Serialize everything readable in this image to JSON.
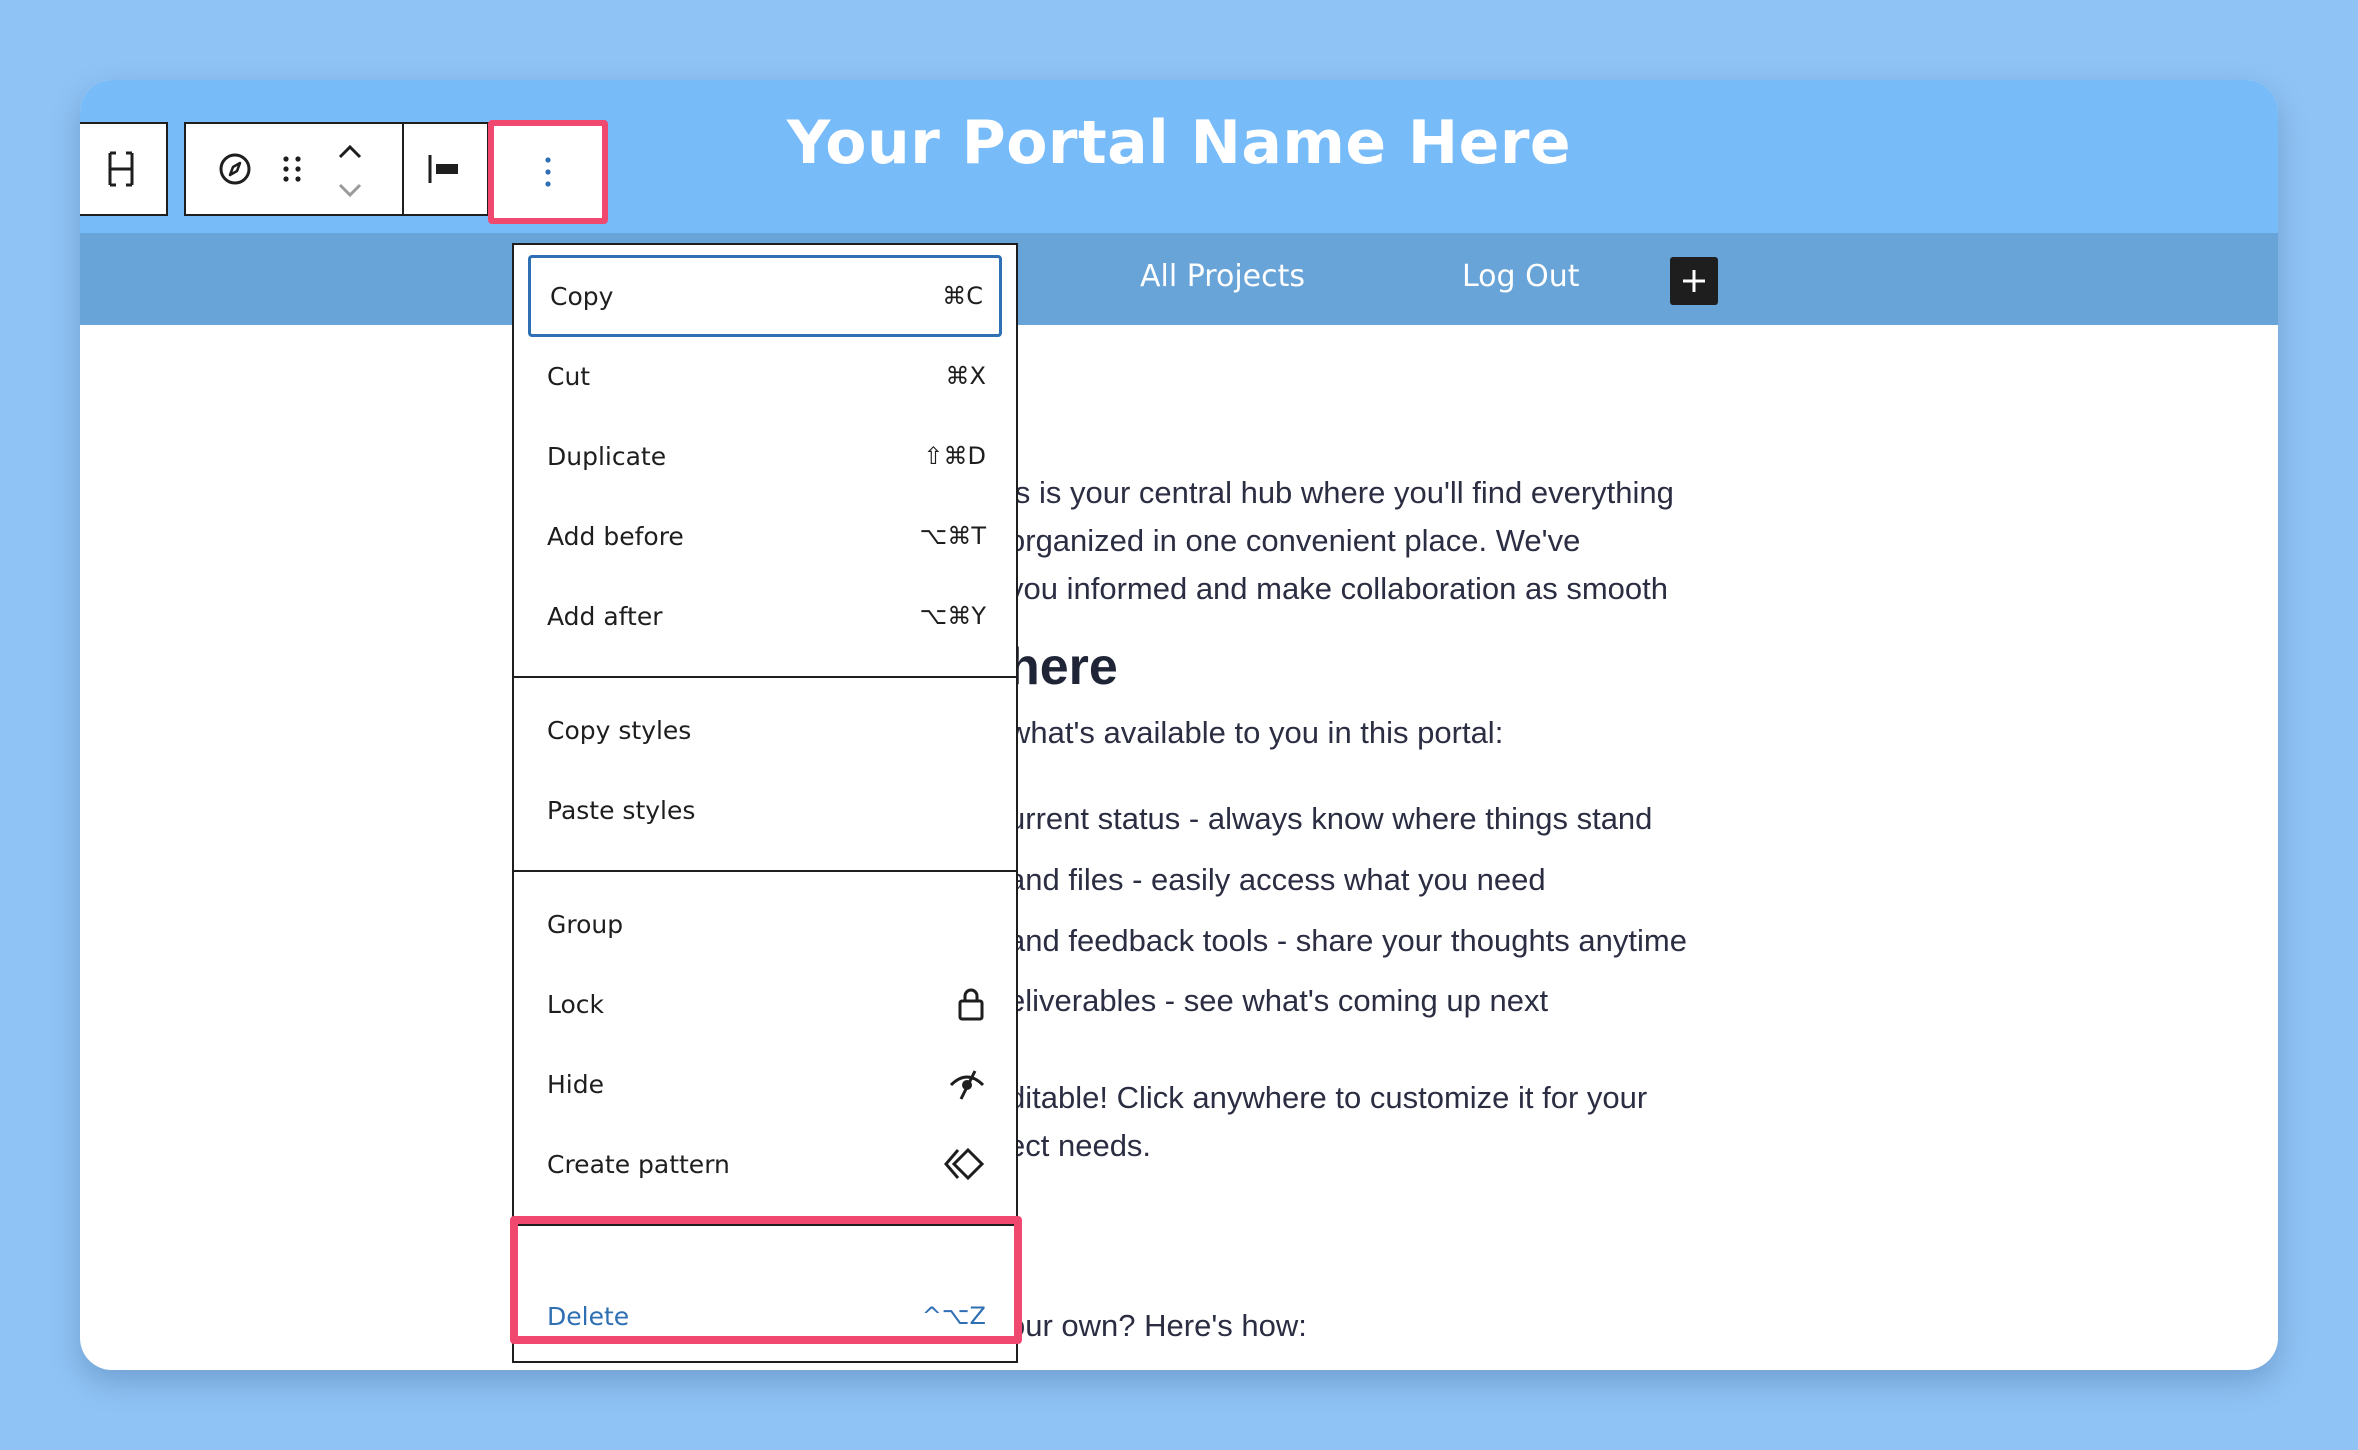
{
  "header": {
    "portal_title": "Your Portal Name Here"
  },
  "nav": {
    "links": [
      "All Projects",
      "Log Out"
    ],
    "add_button": "+"
  },
  "content": {
    "paragraph_lines": [
      "is is your central hub where you'll find everything",
      "organized in one convenient place. We've",
      "you informed and make collaboration as smooth"
    ],
    "heading": "here",
    "intro": "what's available to you in this portal:",
    "list": [
      "urrent status - always know where things stand",
      "and files - easily access what you need",
      "and feedback tools - share your thoughts anytime",
      "eliverables - see what's coming up next"
    ],
    "note_lines": [
      "ditable! Click anywhere to customize it for your",
      "ect needs."
    ],
    "closing": "our own? Here's how:"
  },
  "menu": {
    "group1": [
      {
        "label": "Copy",
        "shortcut": "⌘C"
      },
      {
        "label": "Cut",
        "shortcut": "⌘X"
      },
      {
        "label": "Duplicate",
        "shortcut": "⇧⌘D"
      },
      {
        "label": "Add before",
        "shortcut": "⌥⌘T"
      },
      {
        "label": "Add after",
        "shortcut": "⌥⌘Y"
      }
    ],
    "group2": [
      {
        "label": "Copy styles"
      },
      {
        "label": "Paste styles"
      }
    ],
    "group3": [
      {
        "label": "Group"
      },
      {
        "label": "Lock",
        "icon": "lock-icon"
      },
      {
        "label": "Hide",
        "icon": "eye-slash-icon"
      },
      {
        "label": "Create pattern",
        "icon": "pattern-diamond-icon"
      }
    ],
    "delete": {
      "label": "Delete",
      "shortcut": "^⌥Z"
    }
  },
  "colors": {
    "page_bg": "#90c3f5",
    "header": "#78bbf9",
    "nav": "#68a4d7",
    "highlight": "#f0486f",
    "accent": "#2f6fb3"
  }
}
